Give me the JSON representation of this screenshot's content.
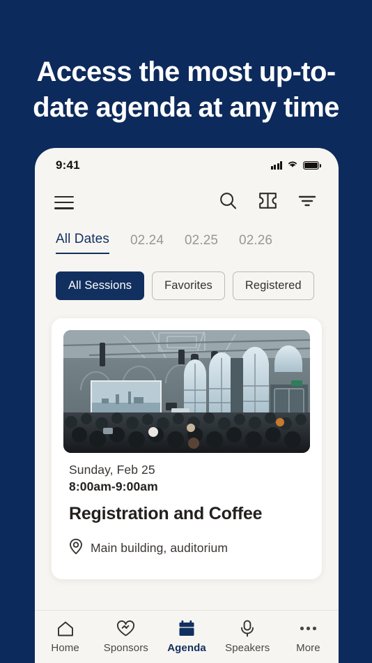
{
  "headline": "Access the most up-to-date agenda at any time",
  "colors": {
    "background_navy": "#0d2a5c",
    "accent_navy": "#11305f",
    "phone_bg": "#f7f5f1",
    "card_bg": "#ffffff",
    "muted_text": "#9a9792"
  },
  "status_bar": {
    "time": "9:41",
    "signal_icon": "cellular-signal-icon",
    "wifi_icon": "wifi-icon",
    "battery_icon": "battery-full-icon"
  },
  "toolbar": {
    "menu_icon": "hamburger-menu-icon",
    "search_icon": "search-icon",
    "ticket_icon": "ticket-icon",
    "filter_icon": "filter-icon"
  },
  "date_tabs": [
    {
      "label": "All Dates",
      "active": true
    },
    {
      "label": "02.24",
      "active": false
    },
    {
      "label": "02.25",
      "active": false
    },
    {
      "label": "02.26",
      "active": false
    }
  ],
  "filter_chips": [
    {
      "label": "All Sessions",
      "active": true
    },
    {
      "label": "Favorites",
      "active": false
    },
    {
      "label": "Registered",
      "active": false
    }
  ],
  "session_card": {
    "image_alt": "conference-hall-audience-photo",
    "date": "Sunday, Feb 25",
    "time": "8:00am-9:00am",
    "title": "Registration and Coffee",
    "location_icon": "map-pin-icon",
    "location": "Main building, auditorium"
  },
  "bottom_nav": [
    {
      "label": "Home",
      "icon": "home-icon",
      "active": false
    },
    {
      "label": "Sponsors",
      "icon": "heart-handshake-icon",
      "active": false
    },
    {
      "label": "Agenda",
      "icon": "calendar-icon",
      "active": true
    },
    {
      "label": "Speakers",
      "icon": "microphone-icon",
      "active": false
    },
    {
      "label": "More",
      "icon": "ellipsis-icon",
      "active": false
    }
  ]
}
